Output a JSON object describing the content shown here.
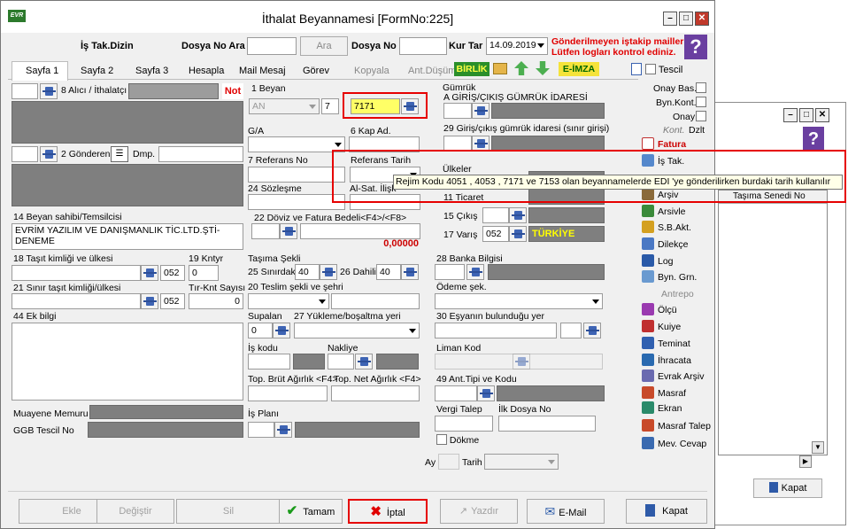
{
  "main_window": {
    "title": "İthalat Beyannamesi [FormNo:225]"
  },
  "header": {
    "is_tak_dizin": "İş Tak.Dizin",
    "dosya_no_ara_label": "Dosya No Ara",
    "ara_button": "Ara",
    "dosya_no_label": "Dosya No",
    "kur_tar_label": "Kur Tar",
    "kur_tar_value": "14.09.2019",
    "warning_line1": "Gönderilmeyen iştakip mailler",
    "warning_line2": "Lütfen logları kontrol ediniz."
  },
  "tabs": [
    "Sayfa 1",
    "Sayfa 2",
    "Sayfa 3",
    "Hesapla",
    "Mail Mesaj",
    "Görev",
    "Kopyala",
    "Ant.Düşüm"
  ],
  "toolbar": {
    "birlik": "BİRLİK",
    "e_imza": "E-İMZA",
    "tescil": "Tescil"
  },
  "left": {
    "alici_label": "8 Alıcı / İthalatçı",
    "not_badge": "Not",
    "gonderen_label": "2 Gönderen",
    "dmp_label": "Dmp.",
    "beyan_sahibi_label": "14 Beyan sahibi/Temsilcisi",
    "beyan_sahibi_line1": "EVRİM YAZILIM VE DANIŞMANLIK TİC.LTD.ŞTİ-",
    "beyan_sahibi_line2": "DENEME",
    "tasit_label": "18 Taşıt kimliği ve ülkesi",
    "tasit_code": "052",
    "kntyr_label": "19 Kntyr",
    "kntyr_value": "0",
    "sinir_tasit_label": "21 Sınır taşıt kimliği/ülkesi",
    "sinir_tasit_code": "052",
    "tir_knt_label": "Tır-Knt Sayısı",
    "tir_knt_value": "0",
    "ek_bilgi_label": "44 Ek bilgi",
    "muayene_label": "Muayene Memuru",
    "ggb_label": "GGB Tescil No"
  },
  "middle": {
    "beyan_label": "1 Beyan",
    "beyan_type": "AN",
    "beyan_num": "7",
    "rejim_value": "7171",
    "kap_label": "6 Kap Ad.",
    "ga_label": "G/A",
    "referans_no_label": "7 Referans No",
    "referans_tarih_label": "Referans Tarih",
    "sozlesme_label": "24 Sözleşme",
    "al_sat_label": "Al-Sat. İlişk",
    "doviz_label": "22 Döviz ve Fatura Bedeli<F4>/<F8>",
    "doviz_total": "0,00000",
    "tasima_sekli_label": "Taşıma Şekli",
    "sinirdaki_label": "25 Sınırdaki",
    "sinirdaki_value": "40",
    "dahili_label": "26 Dahili",
    "dahili_value": "40",
    "teslim_label": "20 Teslim şekli ve şehri",
    "supalan_label": "Supalan",
    "supalan_value": "0",
    "yukleme_label": "27 Yükleme/boşaltma yeri",
    "is_kodu_label": "İş kodu",
    "nakliye_label": "Nakliye",
    "top_brut_label": "Top. Brüt Ağırlık <F4>",
    "top_net_label": "Top. Net Ağırlık <F4>",
    "is_plani_label": "İş Planı"
  },
  "right_mid": {
    "gumruk_label": "Gümrük",
    "gumruk_sub": "A GİRİŞ/ÇIKIŞ GÜMRÜK İDARESİ",
    "giris_label": "29 Giriş/çıkış gümrük idaresi (sınır girişi)",
    "ulkeler_label": "Ülkeler",
    "ticaret_label": "11 Ticaret",
    "cikis_label": "15 Çıkış",
    "varis_label": "17 Varış",
    "varis_code": "052",
    "varis_country": "TÜRKİYE",
    "banka_label": "28 Banka Bilgisi",
    "odeme_label": "Ödeme şek.",
    "esya_label": "30 Eşyanın bulunduğu yer",
    "liman_label": "Liman Kod",
    "ant_tipi_label": "49 Ant.Tipi ve Kodu",
    "vergi_talep_label": "Vergi Talep",
    "ilk_dosya_label": "İlk Dosya No",
    "dokme_label": "Dökme",
    "ay_label": "Ay",
    "tarih_label": "Tarih"
  },
  "side_panel": {
    "onay_bas": "Onay Bas.",
    "byn_kont": "Byn.Kont.",
    "onay": "Onay",
    "kont": "Kont.",
    "dzlt": "Dzlt",
    "buttons": [
      "Fatura",
      "İş Tak.",
      "Arşiv",
      "Arsivle",
      "S.B.Akt.",
      "Dilekçe",
      "Log",
      "Byn. Grn.",
      "Antrepo",
      "Ölçü",
      "Kuiye",
      "Teminat",
      "İhracata",
      "Evrak Arşiv",
      "Masraf",
      "Ekran",
      "Masraf Talep",
      "Mev. Cevap"
    ]
  },
  "tooltip": "Rejim Kodu 4051 , 4053 , 7171 ve 7153 olan beyannamelerde EDI 'ye gönderilirken burdaki tarih kullanılır",
  "bottom": {
    "ekle": "Ekle",
    "degistir": "Değiştir",
    "sil": "Sil",
    "tamam": "Tamam",
    "iptal": "İptal",
    "yazdir": "Yazdır",
    "email": "E-Mail",
    "kapat": "Kapat"
  },
  "second_window": {
    "column_header": "Taşıma Senedi No",
    "kapat": "Kapat"
  }
}
